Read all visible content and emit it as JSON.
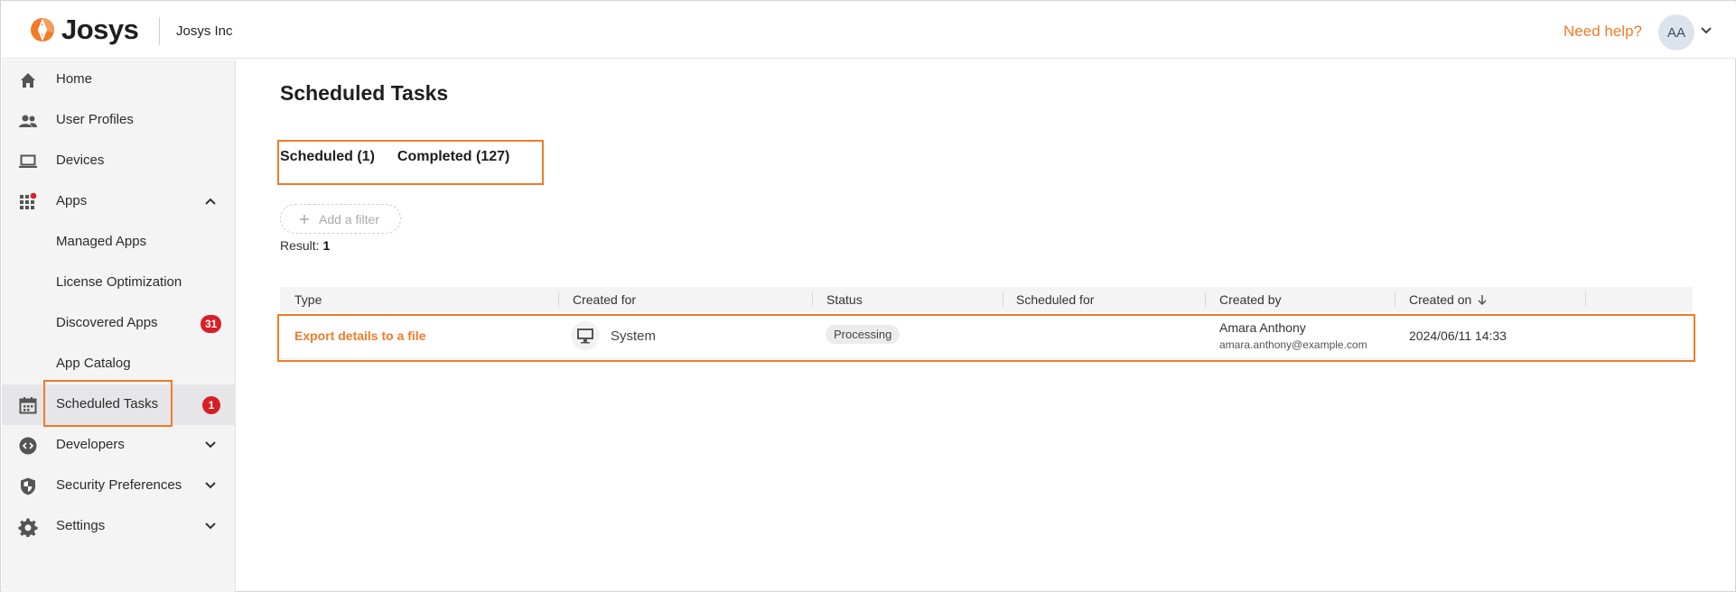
{
  "header": {
    "brand": "Josys",
    "org": "Josys Inc",
    "need_help": "Need help?",
    "avatar_initials": "AA",
    "accent_color": "#f07c28"
  },
  "sidebar": {
    "items": [
      {
        "label": "Home",
        "icon": "home-icon"
      },
      {
        "label": "User Profiles",
        "icon": "users-icon"
      },
      {
        "label": "Devices",
        "icon": "laptop-icon"
      },
      {
        "label": "Apps",
        "icon": "apps-grid-icon",
        "expanded": true
      },
      {
        "label": "Managed Apps"
      },
      {
        "label": "License Optimization"
      },
      {
        "label": "Discovered Apps",
        "badge": "31"
      },
      {
        "label": "App Catalog"
      },
      {
        "label": "Scheduled Tasks",
        "icon": "calendar-icon",
        "badge": "1",
        "active": true
      },
      {
        "label": "Developers",
        "icon": "developer-gear-icon"
      },
      {
        "label": "Security Preferences",
        "icon": "shield-icon"
      },
      {
        "label": "Settings",
        "icon": "gear-icon"
      }
    ]
  },
  "main": {
    "title": "Scheduled Tasks",
    "tabs": [
      {
        "label": "Scheduled (1)"
      },
      {
        "label": "Completed (127)"
      }
    ],
    "add_filter": "Add a filter",
    "result_label": "Result:",
    "result_count": "1",
    "table": {
      "columns": [
        "Type",
        "Created for",
        "Status",
        "Scheduled for",
        "Created by",
        "Created on"
      ],
      "rows": [
        {
          "type": "Export details to a file",
          "created_for": "System",
          "status": "Processing",
          "scheduled_for": "",
          "created_by_name": "Amara Anthony",
          "created_by_email": "amara.anthony@example.com",
          "created_on": "2024/06/11 14:33"
        }
      ]
    }
  }
}
